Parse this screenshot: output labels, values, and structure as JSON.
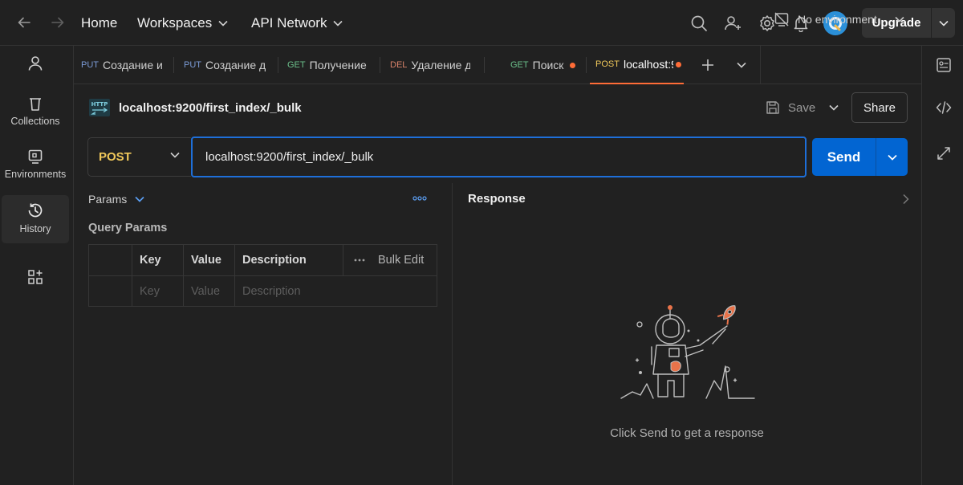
{
  "topbar": {
    "home": "Home",
    "workspaces": "Workspaces",
    "api_network": "API Network",
    "upgrade": "Upgrade"
  },
  "sidebar": {
    "items": [
      {
        "label": "",
        "icon": "user-icon"
      },
      {
        "label": "Collections",
        "icon": "trash-bin-icon"
      },
      {
        "label": "Environments",
        "icon": "environment-icon"
      },
      {
        "label": "History",
        "icon": "history-icon"
      },
      {
        "label": "",
        "icon": "grid-plus-icon"
      }
    ]
  },
  "tabs": [
    {
      "method": "PUT",
      "name": "Создание и"
    },
    {
      "method": "PUT",
      "name": "Создание д"
    },
    {
      "method": "GET",
      "name": "Получение"
    },
    {
      "method": "DEL",
      "name": "Удаление д"
    },
    {
      "method": "GET",
      "name": "Поиск",
      "unsaved": true
    },
    {
      "method": "POST",
      "name": "localhost:9",
      "unsaved": true,
      "active": true
    }
  ],
  "environment": {
    "selected": "No environment"
  },
  "request": {
    "title": "localhost:9200/first_index/_bulk",
    "method": "POST",
    "url": "localhost:9200/first_index/_bulk",
    "save": "Save",
    "share": "Share",
    "send": "Send"
  },
  "params": {
    "tab_label": "Params",
    "section_title": "Query Params",
    "columns": [
      "Key",
      "Value",
      "Description"
    ],
    "bulk_edit": "Bulk Edit",
    "placeholders": [
      "Key",
      "Value",
      "Description"
    ]
  },
  "response": {
    "title": "Response",
    "hint": "Click Send to get a response"
  },
  "colors": {
    "accent_orange": "#ff6c37",
    "send_blue": "#0265d2",
    "post_yellow": "#f0c85a"
  }
}
